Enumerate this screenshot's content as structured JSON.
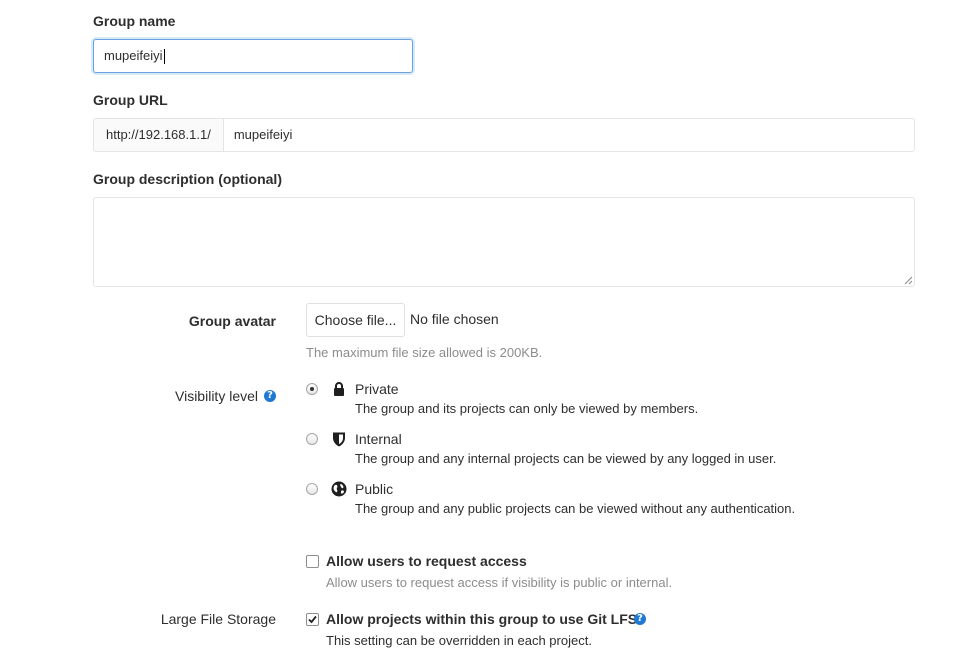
{
  "group_name": {
    "label": "Group name",
    "value": "mupeifeiyi"
  },
  "group_url": {
    "label": "Group URL",
    "prefix": "http://192.168.1.1/",
    "path": "mupeifeiyi"
  },
  "group_description": {
    "label": "Group description (optional)",
    "value": ""
  },
  "avatar": {
    "label": "Group avatar",
    "button_label": "Choose file...",
    "status": "No file chosen",
    "help": "The maximum file size allowed is 200KB."
  },
  "visibility": {
    "label": "Visibility level",
    "help_icon": "question-circle-icon",
    "selected": "Private",
    "options": [
      {
        "title": "Private",
        "icon": "lock-icon",
        "description": "The group and its projects can only be viewed by members."
      },
      {
        "title": "Internal",
        "icon": "shield-icon",
        "description": "The group and any internal projects can be viewed by any logged in user."
      },
      {
        "title": "Public",
        "icon": "globe-icon",
        "description": "The group and any public projects can be viewed without any authentication."
      }
    ]
  },
  "request_access": {
    "checked": false,
    "title": "Allow users to request access",
    "help": "Allow users to request access if visibility is public or internal."
  },
  "lfs": {
    "label": "Large File Storage",
    "checked": true,
    "title": "Allow projects within this group to use Git LFS",
    "help": "This setting can be overridden in each project."
  },
  "colors": {
    "focus_border": "#66a3e0",
    "help_icon": "#1f78d1",
    "muted_text": "#8c8c8c"
  }
}
